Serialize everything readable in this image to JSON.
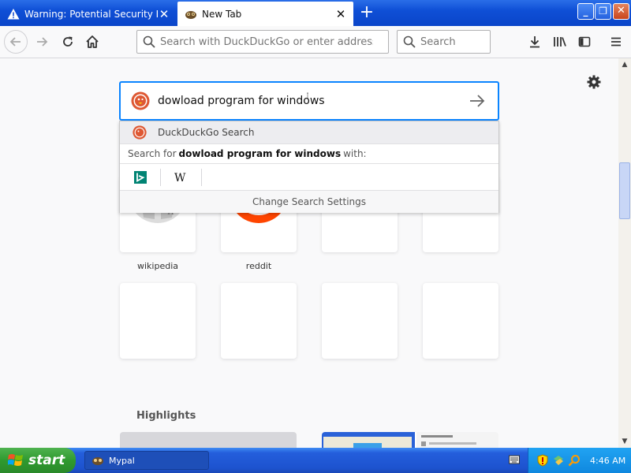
{
  "window": {
    "tabs": [
      {
        "title": "Warning: Potential Security Risk A",
        "active": false,
        "icon": "warning-icon"
      },
      {
        "title": "New Tab",
        "active": true,
        "icon": "mypal-icon"
      }
    ],
    "new_tab_symbol": "+",
    "controls": {
      "minimize": "_",
      "maximize": "❐",
      "close": "✕"
    }
  },
  "toolbar": {
    "url_placeholder": "Search with DuckDuckGo or enter address",
    "search_placeholder": "Search"
  },
  "newtab": {
    "search_value": "dowload program for windows",
    "suggest": {
      "engine_label": "DuckDuckGo Search",
      "search_for_prefix": "Search for",
      "search_for_query": "dowload program for windows",
      "search_for_suffix": "with:",
      "engines": [
        "bing-icon",
        "wikipedia-icon"
      ],
      "change_settings": "Change Search Settings"
    },
    "top_sites": [
      {
        "label": "wikipedia"
      },
      {
        "label": "reddit"
      }
    ],
    "highlights_title": "Highlights"
  },
  "taskbar": {
    "start_label": "start",
    "task_label": "Mypal",
    "clock": "4:46 AM"
  },
  "colors": {
    "accent": "#0a84ff",
    "ddg_orange": "#de5833",
    "reddit_orange": "#ff4500",
    "xp_blue": "#245edc",
    "xp_green": "#2f9a2f"
  }
}
